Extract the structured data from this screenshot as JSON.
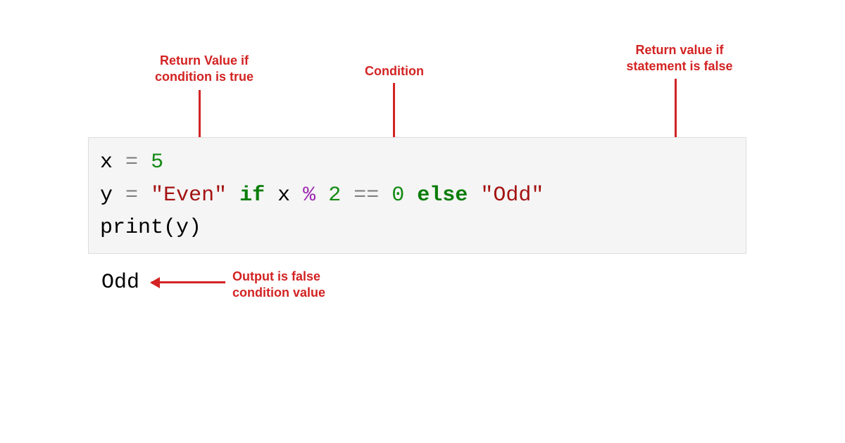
{
  "annotations": {
    "true_return": "Return Value if\ncondition is true",
    "condition": "Condition",
    "false_return": "Return value if\nstatement is false",
    "output_note": "Output is false\ncondition value"
  },
  "code": {
    "line1": {
      "var": "x",
      "assign": "=",
      "val": "5"
    },
    "line2": {
      "var": "y",
      "assign": "=",
      "true_val": "\"Even\"",
      "if": "if",
      "cond_var": "x",
      "mod": "%",
      "mod_val": "2",
      "eq": "==",
      "zero": "0",
      "else": "else",
      "false_val": "\"Odd\""
    },
    "line3": {
      "func": "print",
      "open": "(",
      "arg": "y",
      "close": ")"
    }
  },
  "output": "Odd"
}
